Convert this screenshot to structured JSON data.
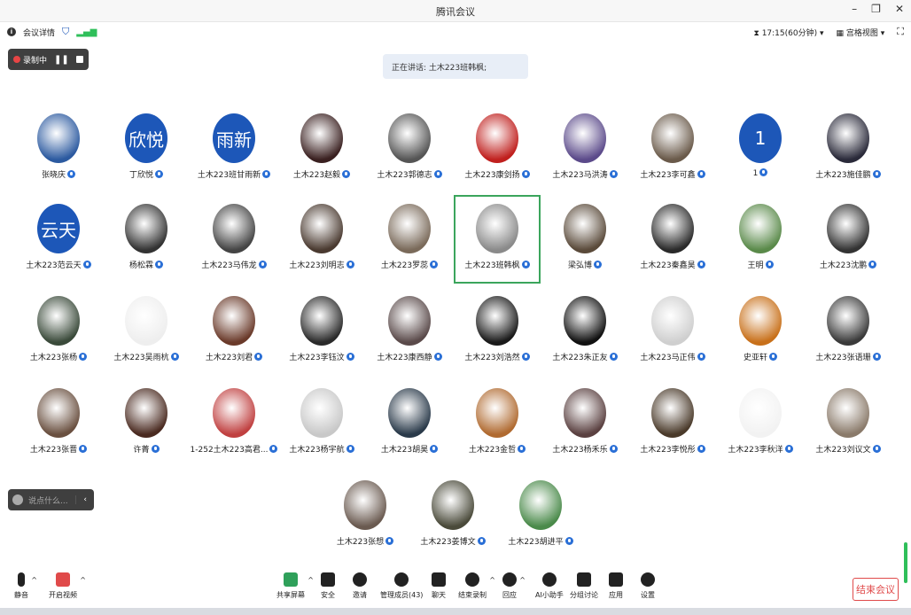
{
  "window": {
    "title": "腾讯会议"
  },
  "infobar": {
    "details": "会议详情",
    "time": "17:15(60分钟)",
    "view": "宫格视图"
  },
  "recording": {
    "label": "录制中"
  },
  "speaking": {
    "text": "正在讲话: 土木223班韩枫;"
  },
  "chat": {
    "placeholder": "说点什么..."
  },
  "participants": [
    {
      "name": "张晓庆",
      "avatar": "photo",
      "color": "#2c5aa0"
    },
    {
      "name": "丁欣悦",
      "avatar": "欣悦"
    },
    {
      "name": "土木223班甘雨新",
      "avatar": "雨新"
    },
    {
      "name": "土木223赵毅",
      "avatar": "photo",
      "color": "#3a2020"
    },
    {
      "name": "土木223郭德志",
      "avatar": "photo",
      "color": "#555"
    },
    {
      "name": "土木223康剑扬",
      "avatar": "photo",
      "color": "#c0201e"
    },
    {
      "name": "土木223马洪涛",
      "avatar": "photo",
      "color": "#5b4a8a"
    },
    {
      "name": "土木223李可鑫",
      "avatar": "photo",
      "color": "#6a5a4a"
    },
    {
      "name": "1",
      "avatar": "1"
    },
    {
      "name": "土木223施佳鹏",
      "avatar": "photo",
      "color": "#2a2a3a"
    },
    {
      "name": "土木223范云天",
      "avatar": "云天"
    },
    {
      "name": "杨松霖",
      "avatar": "photo",
      "color": "#333"
    },
    {
      "name": "土木223马伟龙",
      "avatar": "photo",
      "color": "#444"
    },
    {
      "name": "土木223刘明志",
      "avatar": "photo",
      "color": "#4a3a30"
    },
    {
      "name": "土木223罗蕊",
      "avatar": "photo",
      "color": "#7a6a5a"
    },
    {
      "name": "土木223班韩枫",
      "avatar": "photo",
      "color": "#8a8a8a",
      "active": true
    },
    {
      "name": "梁弘博",
      "avatar": "photo",
      "color": "#5a4a3a"
    },
    {
      "name": "土木223秦鑫昊",
      "avatar": "photo",
      "color": "#2a2a2a"
    },
    {
      "name": "王明",
      "avatar": "photo",
      "color": "#5a8a4a"
    },
    {
      "name": "土木223沈鹏",
      "avatar": "photo",
      "color": "#333"
    },
    {
      "name": "土木223张杨",
      "avatar": "photo",
      "color": "#3a4a3a"
    },
    {
      "name": "土木223吴雨杭",
      "avatar": "photo",
      "color": "#eeeeee"
    },
    {
      "name": "土木223刘君",
      "avatar": "photo",
      "color": "#6a3a2a"
    },
    {
      "name": "土木223李钰汶",
      "avatar": "photo",
      "color": "#2a2a2a"
    },
    {
      "name": "土木223康西静",
      "avatar": "photo",
      "color": "#5a4a4a"
    },
    {
      "name": "土木223刘浩然",
      "avatar": "photo",
      "color": "#1a1a1a"
    },
    {
      "name": "土木223朱正友",
      "avatar": "photo",
      "color": "#111"
    },
    {
      "name": "土木223马正伟",
      "avatar": "photo",
      "color": "#cfcfcf"
    },
    {
      "name": "史亚轩",
      "avatar": "photo",
      "color": "#c8701a"
    },
    {
      "name": "土木223张语珊",
      "avatar": "photo",
      "color": "#3a3a3a"
    },
    {
      "name": "土木223张晋",
      "avatar": "photo",
      "color": "#6a5040"
    },
    {
      "name": "许菁",
      "avatar": "photo",
      "color": "#4a2a20"
    },
    {
      "name": "1-252土木223高君...",
      "avatar": "photo",
      "color": "#c04040"
    },
    {
      "name": "土木223杨宇航",
      "avatar": "photo",
      "color": "#c8c8c8"
    },
    {
      "name": "土木223胡昊",
      "avatar": "photo",
      "color": "#2a3a4a"
    },
    {
      "name": "土木223金哲",
      "avatar": "photo",
      "color": "#b06a30"
    },
    {
      "name": "土木223杨禾乐",
      "avatar": "photo",
      "color": "#5a4040"
    },
    {
      "name": "土木223李悦彤",
      "avatar": "photo",
      "color": "#4a3a2a"
    },
    {
      "name": "土木223李秋洋",
      "avatar": "photo",
      "color": "#f2f2f2"
    },
    {
      "name": "土木223刘议文",
      "avatar": "photo",
      "color": "#8a7a6a"
    },
    {
      "name": "土木223张想",
      "avatar": "photo",
      "color": "#6a5a50"
    },
    {
      "name": "土木223姜博文",
      "avatar": "photo",
      "color": "#4a4a3a"
    },
    {
      "name": "土木223胡进平",
      "avatar": "photo",
      "color": "#4a8a4a"
    }
  ],
  "toolbar": {
    "mute": "静音",
    "video": "开启视频",
    "share": "共享屏幕",
    "security": "安全",
    "invite": "邀请",
    "members": "管理成员(43)",
    "chat": "聊天",
    "end_record": "结束录制",
    "reaction": "回应",
    "ai": "AI小助手",
    "breakout": "分组讨论",
    "apps": "应用",
    "settings": "设置",
    "end_meeting": "结束会议"
  }
}
